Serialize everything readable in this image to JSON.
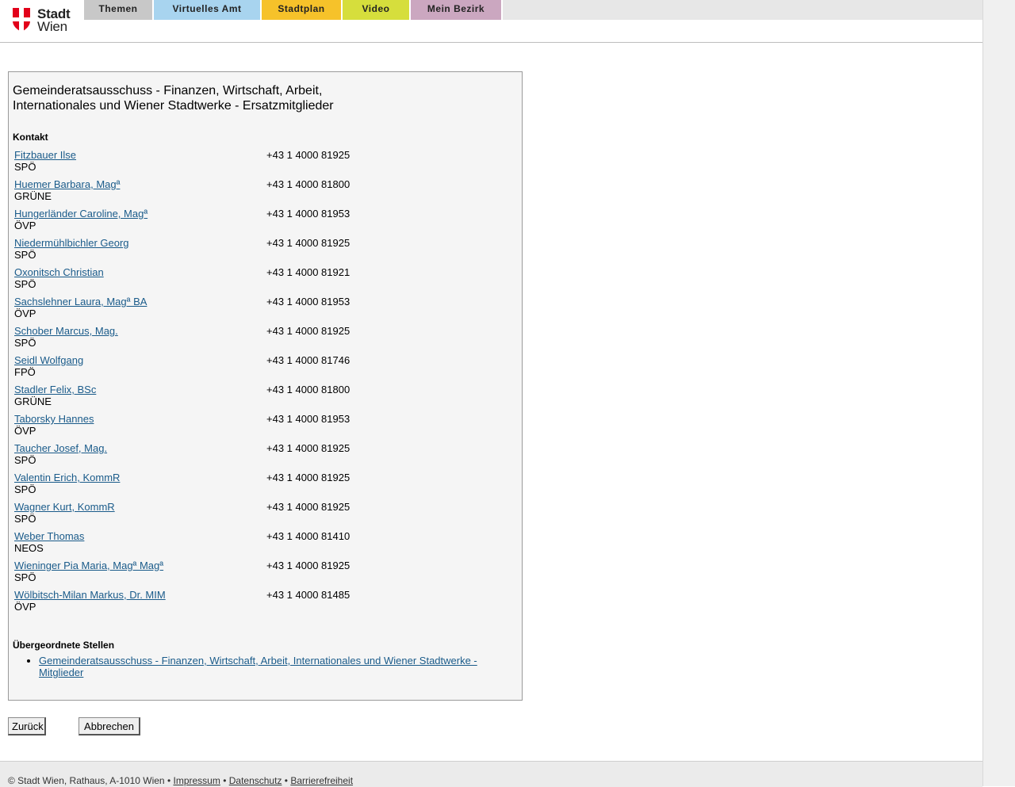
{
  "header": {
    "logo_line1": "Stadt",
    "logo_line2": "Wien",
    "nav": [
      {
        "label": "Themen",
        "color": "#c8c8c8"
      },
      {
        "label": "Virtuelles Amt",
        "color": "#a8d4ef"
      },
      {
        "label": "Stadtplan",
        "color": "#f6c22a"
      },
      {
        "label": "Video",
        "color": "#d6de3c"
      },
      {
        "label": "Mein Bezirk",
        "color": "#cba7c0"
      }
    ]
  },
  "panel": {
    "title_line1": "Gemeinderatsausschuss - Finanzen, Wirtschaft, Arbeit,",
    "title_line2": "Internationales und Wiener Stadtwerke - Ersatzmitglieder",
    "contact_label": "Kontakt",
    "members": [
      {
        "name": "Fitzbauer Ilse",
        "party": "SPÖ",
        "phone": "+43 1 4000 81925"
      },
      {
        "name": "Huemer Barbara, Magª",
        "party": "GRÜNE",
        "phone": "+43 1 4000 81800"
      },
      {
        "name": "Hungerländer Caroline, Magª",
        "party": "ÖVP",
        "phone": "+43 1 4000 81953"
      },
      {
        "name": "Niedermühlbichler Georg",
        "party": "SPÖ",
        "phone": "+43 1 4000 81925"
      },
      {
        "name": "Oxonitsch Christian",
        "party": "SPÖ",
        "phone": "+43 1 4000 81921"
      },
      {
        "name": "Sachslehner Laura, Magª BA",
        "party": "ÖVP",
        "phone": "+43 1 4000 81953"
      },
      {
        "name": "Schober Marcus, Mag.",
        "party": "SPÖ",
        "phone": "+43 1 4000 81925"
      },
      {
        "name": "Seidl Wolfgang",
        "party": "FPÖ",
        "phone": "+43 1 4000 81746"
      },
      {
        "name": "Stadler Felix, BSc",
        "party": "GRÜNE",
        "phone": "+43 1 4000 81800"
      },
      {
        "name": "Taborsky Hannes",
        "party": "ÖVP",
        "phone": "+43 1 4000 81953"
      },
      {
        "name": "Taucher Josef, Mag.",
        "party": "SPÖ",
        "phone": "+43 1 4000 81925"
      },
      {
        "name": "Valentin Erich, KommR",
        "party": "SPÖ",
        "phone": "+43 1 4000 81925"
      },
      {
        "name": "Wagner Kurt, KommR",
        "party": "SPÖ",
        "phone": "+43 1 4000 81925"
      },
      {
        "name": "Weber Thomas",
        "party": "NEOS",
        "phone": "+43 1 4000 81410"
      },
      {
        "name": "Wieninger Pia Maria, Magª Magª",
        "party": "SPÖ",
        "phone": "+43 1 4000 81925"
      },
      {
        "name": "Wölbitsch-Milan Markus, Dr. MIM",
        "party": "ÖVP",
        "phone": "+43 1 4000 81485"
      }
    ],
    "parent_label": "Übergeordnete Stellen",
    "parent_link": "Gemeinderatsausschuss - Finanzen, Wirtschaft, Arbeit, Internationales und Wiener Stadtwerke - Mitglieder"
  },
  "buttons": {
    "back": "Zurück",
    "cancel": "Abbrechen"
  },
  "footer": {
    "copyright": "© Stadt Wien, Rathaus, A-1010 Wien",
    "separator": "•",
    "impressum": "Impressum",
    "datenschutz": "Datenschutz",
    "barrierefreiheit": "Barrierefreiheit"
  }
}
